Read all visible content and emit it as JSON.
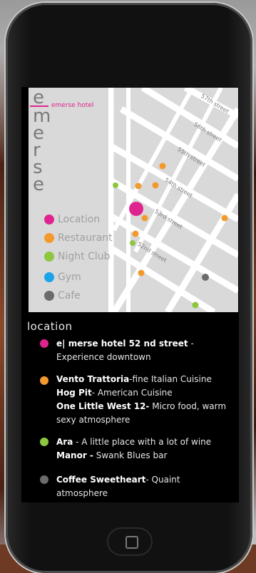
{
  "brand": {
    "letters": [
      "e",
      "m",
      "e",
      "r",
      "s",
      "e"
    ],
    "name": "emerse hotel"
  },
  "map": {
    "streets": [
      "57th street",
      "56th street",
      "55th street",
      "54th street",
      "53rd street",
      "52nd street"
    ]
  },
  "legend": [
    {
      "label": "Location",
      "color": "#e0248f"
    },
    {
      "label": "Restaurant",
      "color": "#f29a2e"
    },
    {
      "label": "Night Club",
      "color": "#8dc63f"
    },
    {
      "label": "Gym",
      "color": "#1aa3e8"
    },
    {
      "label": "Cafe",
      "color": "#6b6b6b"
    }
  ],
  "section_title": "location",
  "entries": [
    {
      "color": "#e0248f",
      "lines": [
        {
          "bold": "e| merse hotel 52 nd street",
          "text": " -  Experience downtown"
        }
      ]
    },
    {
      "color": "#f29a2e",
      "lines": [
        {
          "bold": "Vento Trattoria",
          "text": "-fine Italian Cuisine"
        },
        {
          "bold": "Hog Pit",
          "text": "- American Cuisine"
        },
        {
          "bold": "One Little West 12-",
          "text": " Micro food, warm sexy atmosphere"
        }
      ]
    },
    {
      "color": "#8dc63f",
      "lines": [
        {
          "bold": "Ara",
          "text": " -  A little place with a lot of wine"
        },
        {
          "bold": "Manor -",
          "text": " Swank Blues bar"
        }
      ]
    },
    {
      "color": "#6b6b6b",
      "lines": [
        {
          "bold": "Coffee Sweetheart",
          "text": "-  Quaint atmosphere"
        }
      ]
    }
  ]
}
